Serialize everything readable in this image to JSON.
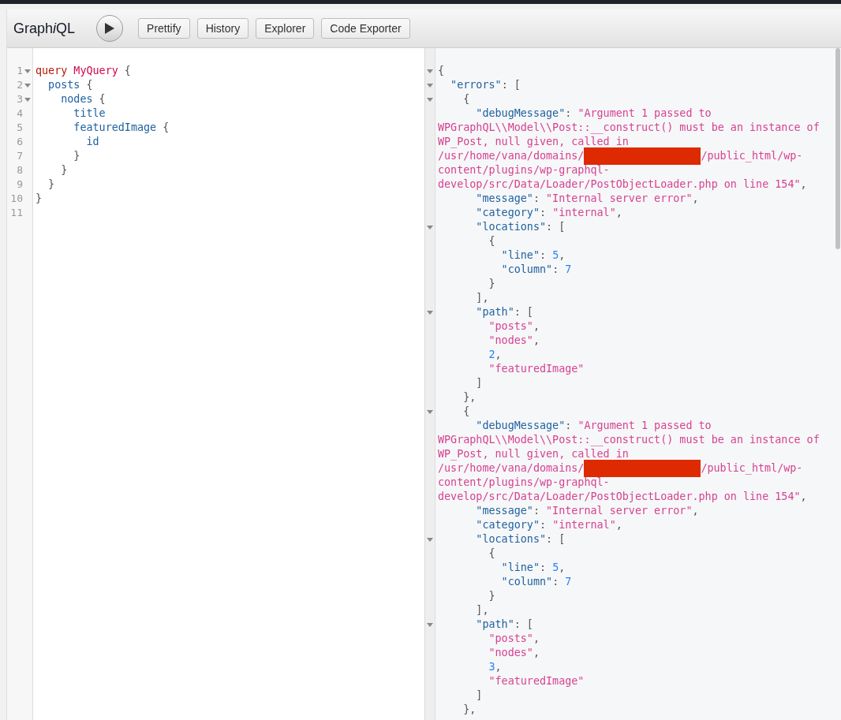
{
  "toolbar": {
    "logo": {
      "prefix": "Graph",
      "italic": "i",
      "suffix": "QL"
    },
    "buttons": [
      "Prettify",
      "History",
      "Explorer",
      "Code Exporter"
    ]
  },
  "query_editor": {
    "lines": [
      {
        "number": "1",
        "fold": true,
        "tokens": [
          {
            "kind": "keyword",
            "text": "query"
          },
          {
            "kind": "def",
            "text": " MyQuery"
          },
          {
            "kind": "punct",
            "text": " {"
          }
        ]
      },
      {
        "number": "2",
        "fold": true,
        "tokens": [
          {
            "kind": "field",
            "text": "  posts"
          },
          {
            "kind": "punct",
            "text": " {"
          }
        ]
      },
      {
        "number": "3",
        "fold": true,
        "tokens": [
          {
            "kind": "field",
            "text": "    nodes"
          },
          {
            "kind": "punct",
            "text": " {"
          }
        ]
      },
      {
        "number": "4",
        "fold": false,
        "tokens": [
          {
            "kind": "field",
            "text": "      title"
          }
        ]
      },
      {
        "number": "5",
        "fold": false,
        "tokens": [
          {
            "kind": "field",
            "text": "      featuredImage"
          },
          {
            "kind": "punct",
            "text": " {"
          }
        ]
      },
      {
        "number": "6",
        "fold": false,
        "tokens": [
          {
            "kind": "field",
            "text": "        id"
          }
        ]
      },
      {
        "number": "7",
        "fold": false,
        "tokens": [
          {
            "kind": "punct",
            "text": "      }"
          }
        ]
      },
      {
        "number": "8",
        "fold": false,
        "tokens": [
          {
            "kind": "punct",
            "text": "    }"
          }
        ]
      },
      {
        "number": "9",
        "fold": false,
        "tokens": [
          {
            "kind": "punct",
            "text": "  }"
          }
        ]
      },
      {
        "number": "10",
        "fold": false,
        "tokens": [
          {
            "kind": "punct",
            "text": "}"
          }
        ]
      },
      {
        "number": "11",
        "fold": false
      }
    ]
  },
  "result": {
    "lines": [
      {
        "fold": true,
        "tokens": [
          {
            "kind": "punct",
            "text": "{"
          }
        ]
      },
      {
        "fold": true,
        "tokens": [
          {
            "kind": "key",
            "text": "  \"errors\""
          },
          {
            "kind": "punct",
            "text": ": ["
          }
        ]
      },
      {
        "fold": true,
        "tokens": [
          {
            "kind": "punct",
            "text": "    {"
          }
        ]
      },
      {
        "fold": false,
        "tokens": [
          {
            "kind": "key",
            "text": "      \"debugMessage\""
          },
          {
            "kind": "punct",
            "text": ": "
          },
          {
            "kind": "string",
            "text": "\"Argument 1 passed to"
          }
        ]
      },
      {
        "fold": false,
        "tokens": [
          {
            "kind": "string",
            "text": "WPGraphQL\\\\Model\\\\Post::__construct() must be an instance of"
          }
        ]
      },
      {
        "fold": false,
        "tokens": [
          {
            "kind": "string",
            "text": "WP_Post, null given, called in"
          }
        ]
      },
      {
        "fold": false,
        "tokens": [
          {
            "kind": "string",
            "text": "/usr/home/vana/domains/"
          },
          {
            "kind": "redaction"
          },
          {
            "kind": "string",
            "text": "/public_html/wp-"
          }
        ]
      },
      {
        "fold": false,
        "tokens": [
          {
            "kind": "string",
            "text": "content/plugins/wp-graphql-"
          }
        ]
      },
      {
        "fold": false,
        "tokens": [
          {
            "kind": "string",
            "text": "develop/src/Data/Loader/PostObjectLoader.php on line 154\""
          },
          {
            "kind": "punct",
            "text": ","
          }
        ]
      },
      {
        "fold": false,
        "tokens": [
          {
            "kind": "key",
            "text": "      \"message\""
          },
          {
            "kind": "punct",
            "text": ": "
          },
          {
            "kind": "string",
            "text": "\"Internal server error\""
          },
          {
            "kind": "punct",
            "text": ","
          }
        ]
      },
      {
        "fold": false,
        "tokens": [
          {
            "kind": "key",
            "text": "      \"category\""
          },
          {
            "kind": "punct",
            "text": ": "
          },
          {
            "kind": "string",
            "text": "\"internal\""
          },
          {
            "kind": "punct",
            "text": ","
          }
        ]
      },
      {
        "fold": true,
        "tokens": [
          {
            "kind": "key",
            "text": "      \"locations\""
          },
          {
            "kind": "punct",
            "text": ": ["
          }
        ]
      },
      {
        "fold": false,
        "tokens": [
          {
            "kind": "punct",
            "text": "        {"
          }
        ]
      },
      {
        "fold": false,
        "tokens": [
          {
            "kind": "key",
            "text": "          \"line\""
          },
          {
            "kind": "punct",
            "text": ": "
          },
          {
            "kind": "number",
            "text": "5"
          },
          {
            "kind": "punct",
            "text": ","
          }
        ]
      },
      {
        "fold": false,
        "tokens": [
          {
            "kind": "key",
            "text": "          \"column\""
          },
          {
            "kind": "punct",
            "text": ": "
          },
          {
            "kind": "number",
            "text": "7"
          }
        ]
      },
      {
        "fold": false,
        "tokens": [
          {
            "kind": "punct",
            "text": "        }"
          }
        ]
      },
      {
        "fold": false,
        "tokens": [
          {
            "kind": "punct",
            "text": "      ],"
          }
        ]
      },
      {
        "fold": true,
        "tokens": [
          {
            "kind": "key",
            "text": "      \"path\""
          },
          {
            "kind": "punct",
            "text": ": ["
          }
        ]
      },
      {
        "fold": false,
        "tokens": [
          {
            "kind": "string",
            "text": "        \"posts\""
          },
          {
            "kind": "punct",
            "text": ","
          }
        ]
      },
      {
        "fold": false,
        "tokens": [
          {
            "kind": "string",
            "text": "        \"nodes\""
          },
          {
            "kind": "punct",
            "text": ","
          }
        ]
      },
      {
        "fold": false,
        "tokens": [
          {
            "kind": "number",
            "text": "        2"
          },
          {
            "kind": "punct",
            "text": ","
          }
        ]
      },
      {
        "fold": false,
        "tokens": [
          {
            "kind": "string",
            "text": "        \"featuredImage\""
          }
        ]
      },
      {
        "fold": false,
        "tokens": [
          {
            "kind": "punct",
            "text": "      ]"
          }
        ]
      },
      {
        "fold": false,
        "tokens": [
          {
            "kind": "punct",
            "text": "    },"
          }
        ]
      },
      {
        "fold": true,
        "tokens": [
          {
            "kind": "punct",
            "text": "    {"
          }
        ]
      },
      {
        "fold": false,
        "tokens": [
          {
            "kind": "key",
            "text": "      \"debugMessage\""
          },
          {
            "kind": "punct",
            "text": ": "
          },
          {
            "kind": "string",
            "text": "\"Argument 1 passed to"
          }
        ]
      },
      {
        "fold": false,
        "tokens": [
          {
            "kind": "string",
            "text": "WPGraphQL\\\\Model\\\\Post::__construct() must be an instance of"
          }
        ]
      },
      {
        "fold": false,
        "tokens": [
          {
            "kind": "string",
            "text": "WP_Post, null given, called in"
          }
        ]
      },
      {
        "fold": false,
        "tokens": [
          {
            "kind": "string",
            "text": "/usr/home/vana/domains/"
          },
          {
            "kind": "redaction"
          },
          {
            "kind": "string",
            "text": "/public_html/wp-"
          }
        ]
      },
      {
        "fold": false,
        "tokens": [
          {
            "kind": "string",
            "text": "content/plugins/wp-graphql-"
          }
        ]
      },
      {
        "fold": false,
        "tokens": [
          {
            "kind": "string",
            "text": "develop/src/Data/Loader/PostObjectLoader.php on line 154\""
          },
          {
            "kind": "punct",
            "text": ","
          }
        ]
      },
      {
        "fold": false,
        "tokens": [
          {
            "kind": "key",
            "text": "      \"message\""
          },
          {
            "kind": "punct",
            "text": ": "
          },
          {
            "kind": "string",
            "text": "\"Internal server error\""
          },
          {
            "kind": "punct",
            "text": ","
          }
        ]
      },
      {
        "fold": false,
        "tokens": [
          {
            "kind": "key",
            "text": "      \"category\""
          },
          {
            "kind": "punct",
            "text": ": "
          },
          {
            "kind": "string",
            "text": "\"internal\""
          },
          {
            "kind": "punct",
            "text": ","
          }
        ]
      },
      {
        "fold": true,
        "tokens": [
          {
            "kind": "key",
            "text": "      \"locations\""
          },
          {
            "kind": "punct",
            "text": ": ["
          }
        ]
      },
      {
        "fold": false,
        "tokens": [
          {
            "kind": "punct",
            "text": "        {"
          }
        ]
      },
      {
        "fold": false,
        "tokens": [
          {
            "kind": "key",
            "text": "          \"line\""
          },
          {
            "kind": "punct",
            "text": ": "
          },
          {
            "kind": "number",
            "text": "5"
          },
          {
            "kind": "punct",
            "text": ","
          }
        ]
      },
      {
        "fold": false,
        "tokens": [
          {
            "kind": "key",
            "text": "          \"column\""
          },
          {
            "kind": "punct",
            "text": ": "
          },
          {
            "kind": "number",
            "text": "7"
          }
        ]
      },
      {
        "fold": false,
        "tokens": [
          {
            "kind": "punct",
            "text": "        }"
          }
        ]
      },
      {
        "fold": false,
        "tokens": [
          {
            "kind": "punct",
            "text": "      ],"
          }
        ]
      },
      {
        "fold": true,
        "tokens": [
          {
            "kind": "key",
            "text": "      \"path\""
          },
          {
            "kind": "punct",
            "text": ": ["
          }
        ]
      },
      {
        "fold": false,
        "tokens": [
          {
            "kind": "string",
            "text": "        \"posts\""
          },
          {
            "kind": "punct",
            "text": ","
          }
        ]
      },
      {
        "fold": false,
        "tokens": [
          {
            "kind": "string",
            "text": "        \"nodes\""
          },
          {
            "kind": "punct",
            "text": ","
          }
        ]
      },
      {
        "fold": false,
        "tokens": [
          {
            "kind": "number",
            "text": "        3"
          },
          {
            "kind": "punct",
            "text": ","
          }
        ]
      },
      {
        "fold": false,
        "tokens": [
          {
            "kind": "string",
            "text": "        \"featuredImage\""
          }
        ]
      },
      {
        "fold": false,
        "tokens": [
          {
            "kind": "punct",
            "text": "      ]"
          }
        ]
      },
      {
        "fold": false,
        "tokens": [
          {
            "kind": "punct",
            "text": "    },"
          }
        ]
      }
    ]
  }
}
